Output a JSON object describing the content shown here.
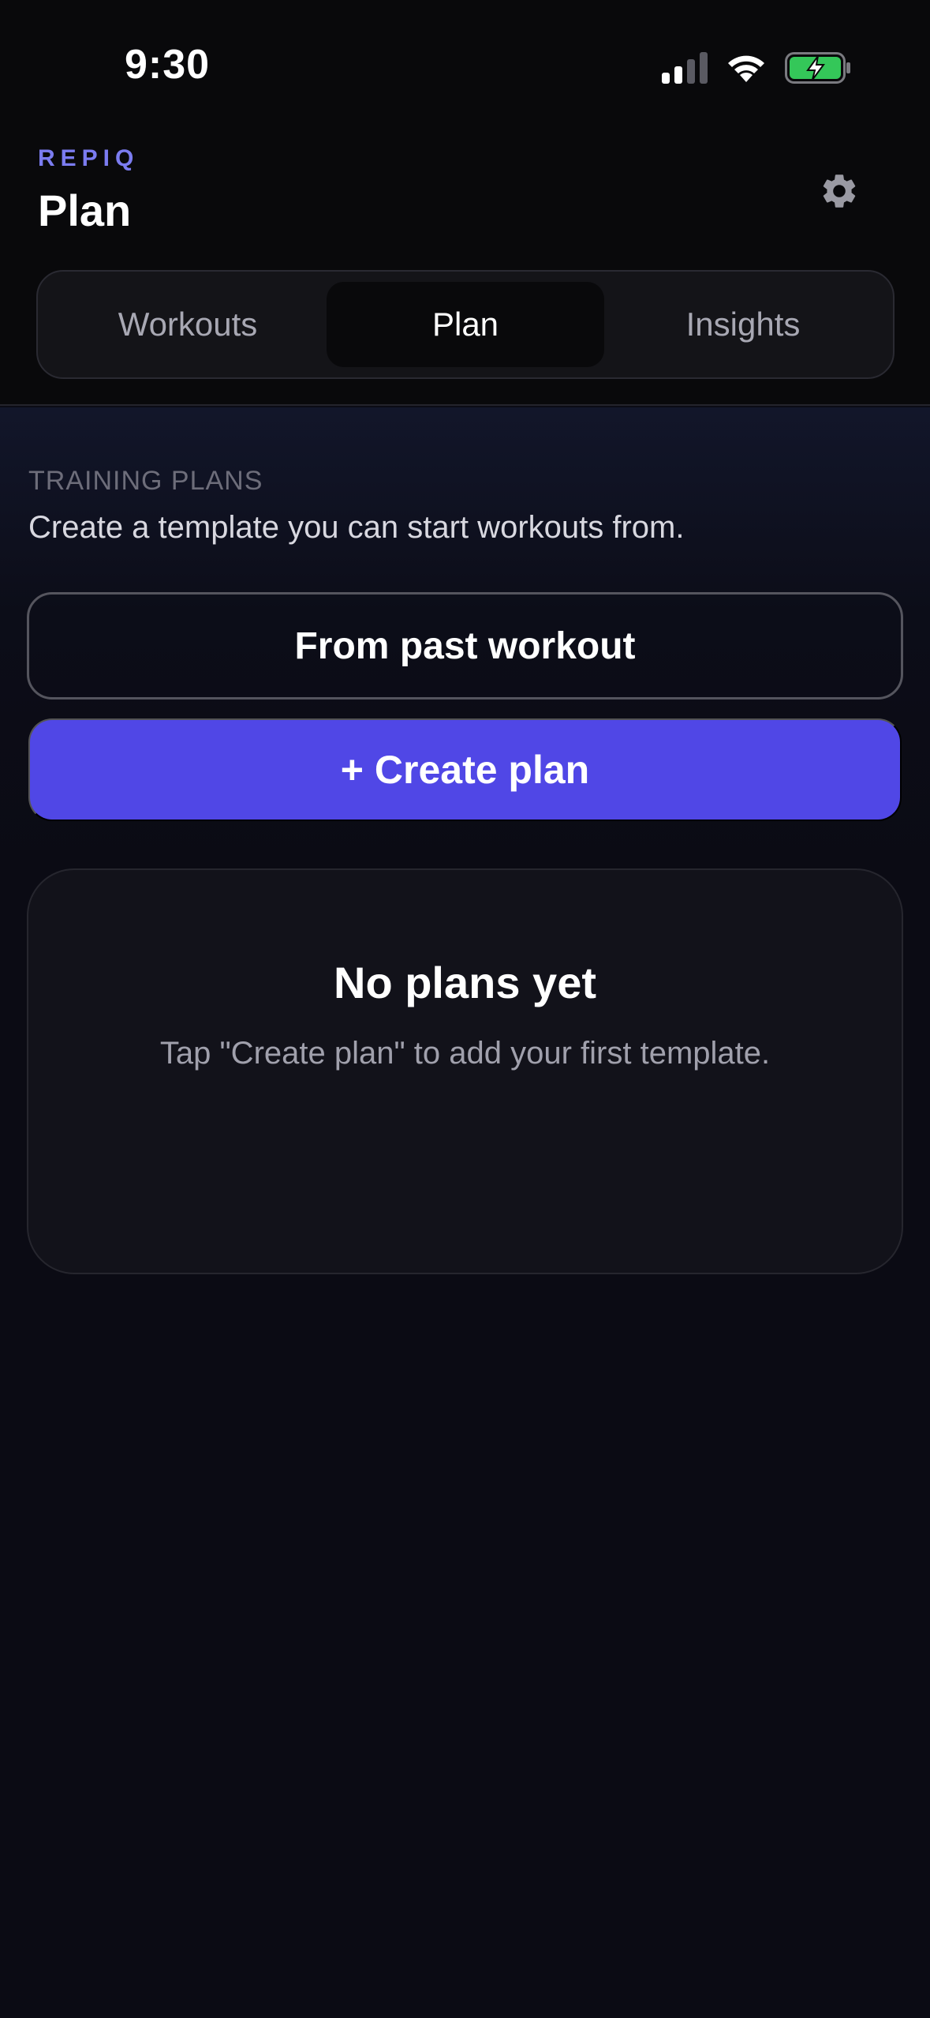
{
  "status_bar": {
    "time": "9:30",
    "icons": [
      "signal-icon",
      "wifi-icon",
      "battery-charging-icon"
    ],
    "battery_color": "#34c759"
  },
  "header": {
    "brand": "REPIQ",
    "title": "Plan",
    "settings_icon": "gear-icon"
  },
  "tabs": [
    {
      "label": "Workouts",
      "active": false
    },
    {
      "label": "Plan",
      "active": true
    },
    {
      "label": "Insights",
      "active": false
    }
  ],
  "section": {
    "label": "TRAINING PLANS",
    "description": "Create a template you can start workouts from."
  },
  "actions": {
    "from_past_label": "From past workout",
    "create_label": "+ Create plan"
  },
  "empty_state": {
    "title": "No plans yet",
    "description": "Tap \"Create plan\" to add your first template."
  },
  "colors": {
    "accent": "#5047e6",
    "brand": "#7b7cf0",
    "background": "#0b0b14"
  }
}
